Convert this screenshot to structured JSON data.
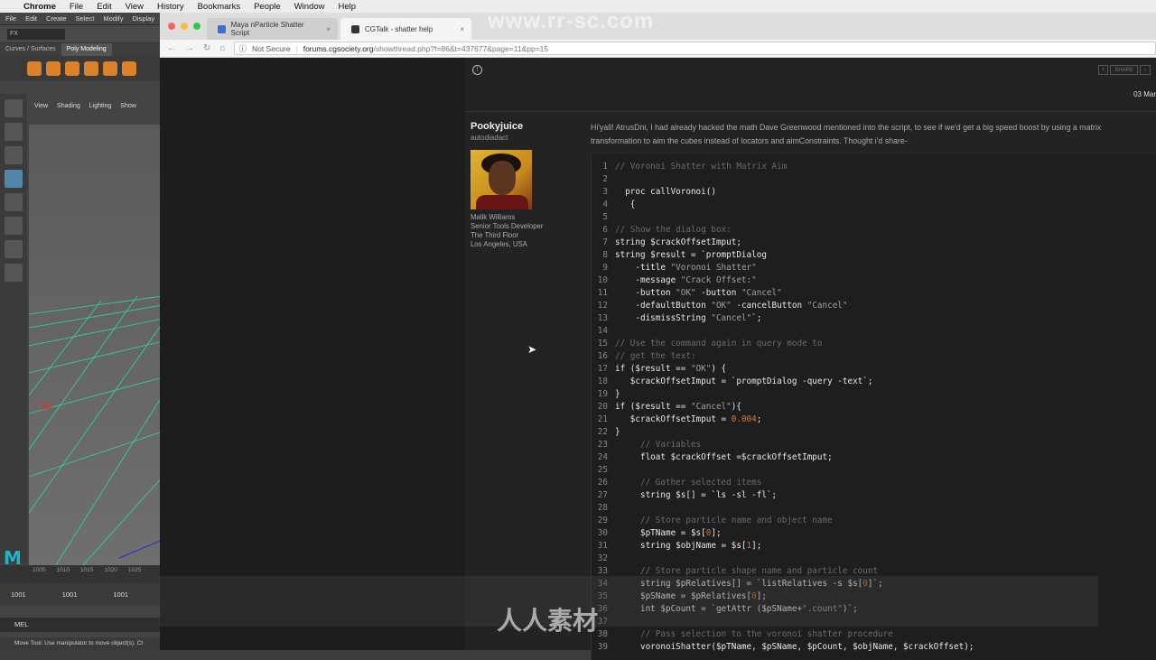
{
  "mac_menu": [
    "Chrome",
    "File",
    "Edit",
    "View",
    "History",
    "Bookmarks",
    "People",
    "Window",
    "Help"
  ],
  "maya": {
    "menu": [
      "File",
      "Edit",
      "Create",
      "Select",
      "Modify",
      "Display"
    ],
    "mode_dropdown": "FX",
    "shelf_tabs": [
      "Curves / Surfaces",
      "Poly Modeling"
    ],
    "viewport_menu": [
      "View",
      "Shading",
      "Lighting",
      "Show"
    ],
    "timeline_ticks": [
      "1005",
      "1010",
      "1015",
      "1020",
      "1025"
    ],
    "current_frame": "1001",
    "start_frame": "1001",
    "end_frame": "1001",
    "script_lang": "MEL",
    "help_line": "Move Tool: Use manipulator to move object(s). Ct"
  },
  "chrome": {
    "tabs": [
      {
        "title": "Maya nParticle Shatter Script",
        "close": "×"
      },
      {
        "title": "CGTalk - shatter help",
        "close": "×"
      }
    ],
    "security_label": "Not Secure",
    "url_host": "forums.cgsociety.org",
    "url_rest": "/showthread.php?f=86&t=437677&page=11&pp=15"
  },
  "watermarks": {
    "top": "www.rr-sc.com",
    "bottom": "人人素材"
  },
  "post": {
    "share_label": "SHARE",
    "date": "03 Mar",
    "author": "Pookyjuice",
    "author_role": "autodiadact",
    "author_details": [
      "Malik Williams",
      "Senior Tools Developer",
      "The Third Floor",
      "Los Angeles, USA"
    ],
    "text": "Hi'yall! AtrusDni, I had already hacked the math Dave Greenwood mentioned into the script, to see if we'd get a big speed boost by using a matrix transformation to aim the cubes instead of locators and aimConstraints. Thought i'd share-",
    "code": [
      {
        "n": "1",
        "parts": [
          {
            "t": "// Voronoi Shatter with Matrix Aim",
            "c": "cmt"
          }
        ]
      },
      {
        "n": "2",
        "parts": []
      },
      {
        "n": "3",
        "parts": [
          {
            "t": "  proc callVoronoi()",
            "c": "src"
          }
        ]
      },
      {
        "n": "4",
        "parts": [
          {
            "t": "   {",
            "c": "src"
          }
        ]
      },
      {
        "n": "5",
        "parts": []
      },
      {
        "n": "6",
        "parts": [
          {
            "t": "// Show the dialog box:",
            "c": "cmt"
          }
        ]
      },
      {
        "n": "7",
        "parts": [
          {
            "t": "string $crackOffsetImput;",
            "c": "src"
          }
        ]
      },
      {
        "n": "8",
        "parts": [
          {
            "t": "string $result = `promptDialog",
            "c": "src"
          }
        ]
      },
      {
        "n": "9",
        "parts": [
          {
            "t": "    -title ",
            "c": "src"
          },
          {
            "t": "\"Voronoi Shatter\"",
            "c": "str"
          }
        ]
      },
      {
        "n": "10",
        "parts": [
          {
            "t": "    -message ",
            "c": "src"
          },
          {
            "t": "\"Crack Offset:\"",
            "c": "str"
          }
        ]
      },
      {
        "n": "11",
        "parts": [
          {
            "t": "    -button ",
            "c": "src"
          },
          {
            "t": "\"OK\"",
            "c": "str"
          },
          {
            "t": " -button ",
            "c": "src"
          },
          {
            "t": "\"Cancel\"",
            "c": "str"
          }
        ]
      },
      {
        "n": "12",
        "parts": [
          {
            "t": "    -defaultButton ",
            "c": "src"
          },
          {
            "t": "\"OK\"",
            "c": "str"
          },
          {
            "t": " -cancelButton ",
            "c": "src"
          },
          {
            "t": "\"Cancel\"",
            "c": "str"
          }
        ]
      },
      {
        "n": "13",
        "parts": [
          {
            "t": "    -dismissString ",
            "c": "src"
          },
          {
            "t": "\"Cancel\"",
            "c": "str"
          },
          {
            "t": "`;",
            "c": "src"
          }
        ]
      },
      {
        "n": "14",
        "parts": []
      },
      {
        "n": "15",
        "parts": [
          {
            "t": "// Use the command again in query mode to",
            "c": "cmt"
          }
        ]
      },
      {
        "n": "16",
        "parts": [
          {
            "t": "// get the text:",
            "c": "cmt"
          }
        ]
      },
      {
        "n": "17",
        "parts": [
          {
            "t": "if ($result == ",
            "c": "src"
          },
          {
            "t": "\"OK\"",
            "c": "str"
          },
          {
            "t": ") {",
            "c": "src"
          }
        ]
      },
      {
        "n": "18",
        "parts": [
          {
            "t": "   $crackOffsetImput = `promptDialog -query -text`;",
            "c": "src"
          }
        ]
      },
      {
        "n": "19",
        "parts": [
          {
            "t": "}",
            "c": "src"
          }
        ]
      },
      {
        "n": "20",
        "parts": [
          {
            "t": "if ($result == ",
            "c": "src"
          },
          {
            "t": "\"Cancel\"",
            "c": "str"
          },
          {
            "t": "){",
            "c": "src"
          }
        ]
      },
      {
        "n": "21",
        "parts": [
          {
            "t": "   $crackOffsetImput = ",
            "c": "src"
          },
          {
            "t": "0.004",
            "c": "num"
          },
          {
            "t": ";",
            "c": "src"
          }
        ]
      },
      {
        "n": "22",
        "parts": [
          {
            "t": "}",
            "c": "src"
          }
        ]
      },
      {
        "n": "23",
        "parts": [
          {
            "t": "     // Variables",
            "c": "cmt"
          }
        ]
      },
      {
        "n": "24",
        "parts": [
          {
            "t": "     float $crackOffset =$crackOffsetImput;",
            "c": "src"
          }
        ]
      },
      {
        "n": "25",
        "parts": []
      },
      {
        "n": "26",
        "parts": [
          {
            "t": "     // Gather selected items",
            "c": "cmt"
          }
        ]
      },
      {
        "n": "27",
        "parts": [
          {
            "t": "     string $s[] = `ls -sl -fl`;",
            "c": "src"
          }
        ]
      },
      {
        "n": "28",
        "parts": []
      },
      {
        "n": "29",
        "parts": [
          {
            "t": "     // Store particle name and object name",
            "c": "cmt"
          }
        ]
      },
      {
        "n": "30",
        "parts": [
          {
            "t": "     $pTName = $s[",
            "c": "src"
          },
          {
            "t": "0",
            "c": "num"
          },
          {
            "t": "];",
            "c": "src"
          }
        ]
      },
      {
        "n": "31",
        "parts": [
          {
            "t": "     string $objName = $s[",
            "c": "src"
          },
          {
            "t": "1",
            "c": "num"
          },
          {
            "t": "];",
            "c": "src"
          }
        ]
      },
      {
        "n": "32",
        "parts": []
      },
      {
        "n": "33",
        "parts": [
          {
            "t": "     // Store particle shape name and particle count",
            "c": "cmt"
          }
        ]
      },
      {
        "n": "34",
        "parts": [
          {
            "t": "     string $pRelatives[] = `listRelatives -s $s[",
            "c": "src"
          },
          {
            "t": "0",
            "c": "num"
          },
          {
            "t": "]`;",
            "c": "src"
          }
        ]
      },
      {
        "n": "35",
        "parts": [
          {
            "t": "     $pSName = $pRelatives[",
            "c": "src"
          },
          {
            "t": "0",
            "c": "num"
          },
          {
            "t": "];",
            "c": "src"
          }
        ]
      },
      {
        "n": "36",
        "parts": [
          {
            "t": "     int $pCount = `getAttr ($pSName+",
            "c": "src"
          },
          {
            "t": "\".count\"",
            "c": "str"
          },
          {
            "t": ")`;",
            "c": "src"
          }
        ]
      },
      {
        "n": "37",
        "parts": []
      },
      {
        "n": "38",
        "parts": [
          {
            "t": "     // Pass selection to the voronoi shatter procedure",
            "c": "cmt"
          }
        ]
      },
      {
        "n": "39",
        "parts": [
          {
            "t": "     voronoiShatter($pTName, $pSName, $pCount, $objName, $crackOffset);",
            "c": "src"
          }
        ]
      }
    ]
  }
}
